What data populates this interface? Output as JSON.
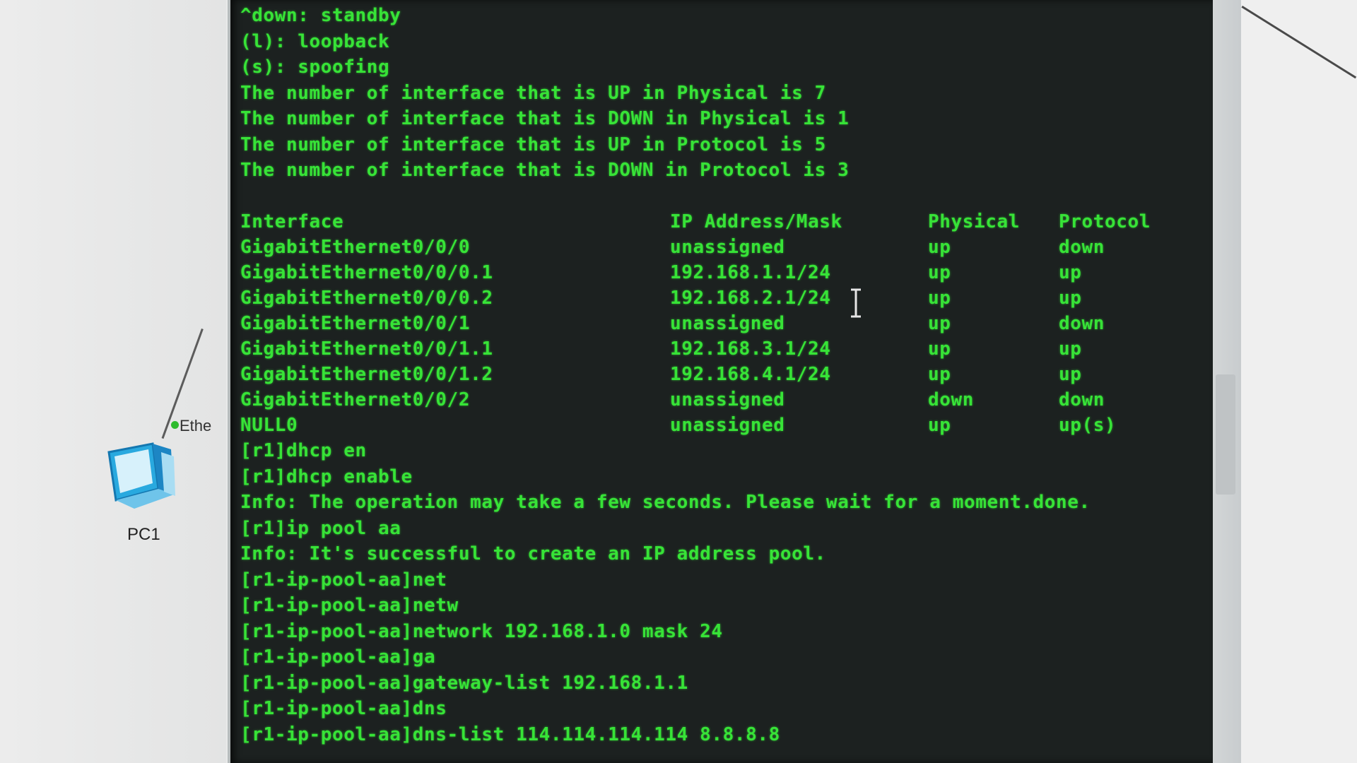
{
  "topology": {
    "pc_label": "PC1",
    "port_label": "Ethe",
    "port_status_color": "#2dbb2d"
  },
  "terminal": {
    "text_color": "#37e337",
    "background": "#1c2120",
    "header_lines": [
      "^down: standby",
      "(l): loopback",
      "(s): spoofing",
      "The number of interface that is UP in Physical is 7",
      "The number of interface that is DOWN in Physical is 1",
      "The number of interface that is UP in Protocol is 5",
      "The number of interface that is DOWN in Protocol is 3"
    ],
    "table": {
      "headers": [
        "Interface",
        "IP Address/Mask",
        "Physical",
        "Protocol"
      ],
      "rows": [
        [
          "GigabitEthernet0/0/0",
          "unassigned",
          "up",
          "down"
        ],
        [
          "GigabitEthernet0/0/0.1",
          "192.168.1.1/24",
          "up",
          "up"
        ],
        [
          "GigabitEthernet0/0/0.2",
          "192.168.2.1/24",
          "up",
          "up"
        ],
        [
          "GigabitEthernet0/0/1",
          "unassigned",
          "up",
          "down"
        ],
        [
          "GigabitEthernet0/0/1.1",
          "192.168.3.1/24",
          "up",
          "up"
        ],
        [
          "GigabitEthernet0/0/1.2",
          "192.168.4.1/24",
          "up",
          "up"
        ],
        [
          "GigabitEthernet0/0/2",
          "unassigned",
          "down",
          "down"
        ],
        [
          "NULL0",
          "unassigned",
          "up",
          "up(s)"
        ]
      ]
    },
    "command_lines": [
      "[r1]dhcp en",
      "[r1]dhcp enable",
      "Info: The operation may take a few seconds. Please wait for a moment.done.",
      "[r1]ip pool aa",
      "Info: It's successful to create an IP address pool.",
      "[r1-ip-pool-aa]net",
      "[r1-ip-pool-aa]netw",
      "[r1-ip-pool-aa]network 192.168.1.0 mask 24",
      "[r1-ip-pool-aa]ga",
      "[r1-ip-pool-aa]gateway-list 192.168.1.1",
      "[r1-ip-pool-aa]dns",
      "[r1-ip-pool-aa]dns-list 114.114.114.114 8.8.8.8"
    ]
  }
}
